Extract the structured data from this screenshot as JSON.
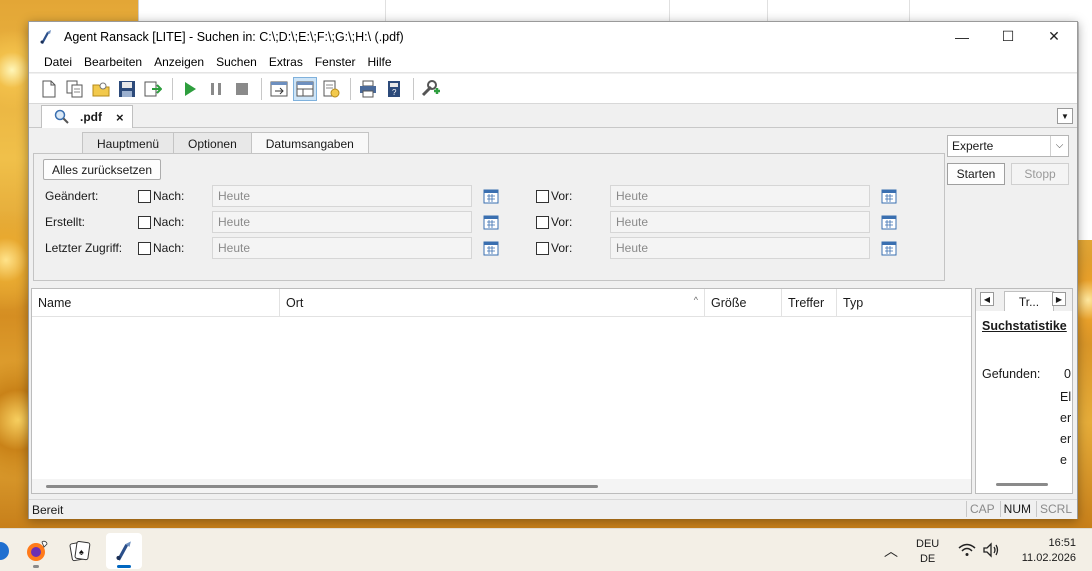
{
  "window": {
    "title": "Agent Ransack [LITE] - Suchen in: C:\\;D:\\;E:\\;F:\\;G:\\;H:\\ (.pdf)",
    "min_glyph": "—",
    "max_glyph": "☐",
    "close_glyph": "✕"
  },
  "menu": {
    "items": [
      "Datei",
      "Bearbeiten",
      "Anzeigen",
      "Suchen",
      "Extras",
      "Fenster",
      "Hilfe"
    ]
  },
  "doc_tab": {
    "label": ".pdf",
    "close": "×"
  },
  "subtabs": [
    "Hauptmenü",
    "Optionen",
    "Datumsangaben"
  ],
  "dates": {
    "reset_label": "Alles zurücksetzen",
    "rows": [
      {
        "label": "Geändert:",
        "after_label": "Nach:",
        "after_value": "Heute",
        "before_label": "Vor:",
        "before_value": "Heute"
      },
      {
        "label": "Erstellt:",
        "after_label": "Nach:",
        "after_value": "Heute",
        "before_label": "Vor:",
        "before_value": "Heute"
      },
      {
        "label": "Letzter Zugriff:",
        "after_label": "Nach:",
        "after_value": "Heute",
        "before_label": "Vor:",
        "before_value": "Heute"
      }
    ]
  },
  "controls": {
    "mode": "Experte",
    "start_label": "Starten",
    "stop_label": "Stopp"
  },
  "results": {
    "columns": [
      "Name",
      "Ort",
      "Größe",
      "Treffer",
      "Typ"
    ],
    "sort_glyph": "^"
  },
  "stats": {
    "tab_label": "Tr...",
    "title": "Suchstatistike",
    "found_label": "Gefunden:",
    "found_count": "0",
    "wrapped_text": [
      "El",
      "er",
      "er",
      "e"
    ]
  },
  "statusbar": {
    "text": "Bereit",
    "indicators": [
      "CAP",
      "NUM",
      "SCRL"
    ]
  },
  "taskbar": {
    "lang_line1": "DEU",
    "lang_line2": "DE",
    "time": "16:51",
    "date": "11.02.2026"
  },
  "colors": {
    "accent": "#0067c0",
    "play_green": "#2e9e3e",
    "calendar_blue": "#3a6fb0"
  },
  "icons": {
    "toolbar": [
      "new-icon",
      "copy-icon",
      "open-folder-icon",
      "save-icon",
      "export-icon",
      "play-icon",
      "pause-icon",
      "stop-icon",
      "view-icon",
      "layout-icon",
      "report-icon",
      "print-icon",
      "book-icon",
      "tools-icon"
    ]
  }
}
